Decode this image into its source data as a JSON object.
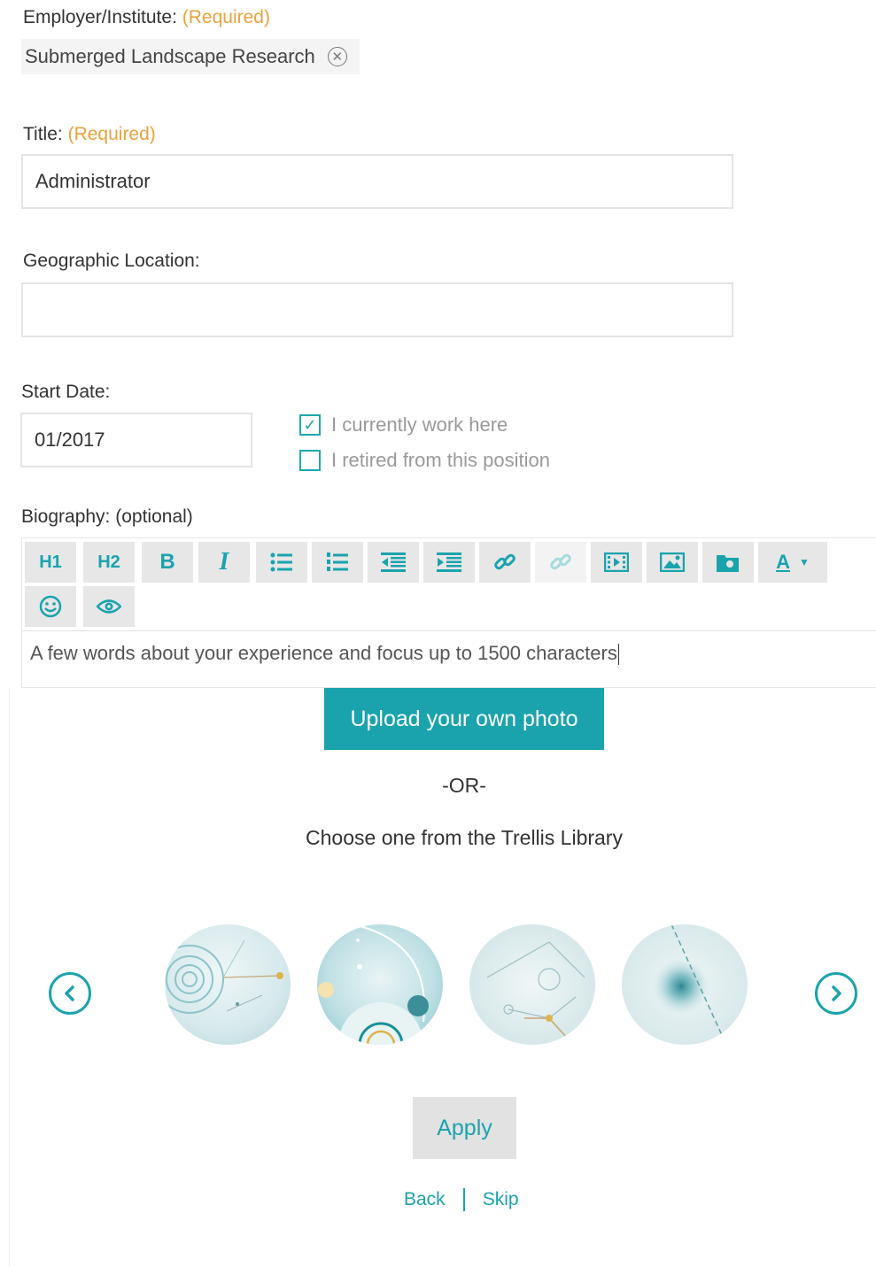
{
  "employer": {
    "label": "Employer/Institute:",
    "required": "(Required)",
    "chip_text": "Submerged Landscape Research",
    "chip_remove_icon": "close-circle-icon"
  },
  "title_field": {
    "label": "Title:",
    "required": "(Required)",
    "value": "Administrator"
  },
  "location_field": {
    "label": "Geographic Location:",
    "value": ""
  },
  "start_date": {
    "label": "Start Date:",
    "value": "01/2017"
  },
  "checkboxes": [
    {
      "label": "I currently work here",
      "checked": true
    },
    {
      "label": "I retired from this position",
      "checked": false
    }
  ],
  "biography": {
    "label": "Biography: (optional)",
    "placeholder": "A few words about your experience and focus up to 1500 characters",
    "toolbar": [
      {
        "label": "H1",
        "icon": "heading1-icon"
      },
      {
        "label": "H2",
        "icon": "heading2-icon"
      },
      {
        "label": "B",
        "icon": "bold-icon"
      },
      {
        "label": "I",
        "icon": "italic-icon"
      },
      {
        "label": "",
        "icon": "bulleted-list-icon"
      },
      {
        "label": "",
        "icon": "numbered-list-icon"
      },
      {
        "label": "",
        "icon": "outdent-icon"
      },
      {
        "label": "",
        "icon": "indent-icon"
      },
      {
        "label": "",
        "icon": "link-icon"
      },
      {
        "label": "",
        "icon": "unlink-icon"
      },
      {
        "label": "",
        "icon": "video-icon"
      },
      {
        "label": "",
        "icon": "image-icon"
      },
      {
        "label": "",
        "icon": "media-library-icon"
      },
      {
        "label": "A",
        "icon": "text-color-icon"
      },
      {
        "label": "",
        "icon": "emoji-icon"
      },
      {
        "label": "",
        "icon": "preview-eye-icon"
      }
    ]
  },
  "photo": {
    "upload_label": "Upload your own photo",
    "or_text": "-OR-",
    "library_text": "Choose one from the Trellis Library",
    "prev_icon": "chevron-left-circle-icon",
    "next_icon": "chevron-right-circle-icon",
    "apply_label": "Apply"
  },
  "footer": {
    "back_label": "Back",
    "skip_label": "Skip"
  },
  "colors": {
    "accent": "#1aa3ad",
    "required": "#e8a33a",
    "toolbar_bg": "#e7e7e7",
    "apply_bg": "#e2e2e2"
  }
}
